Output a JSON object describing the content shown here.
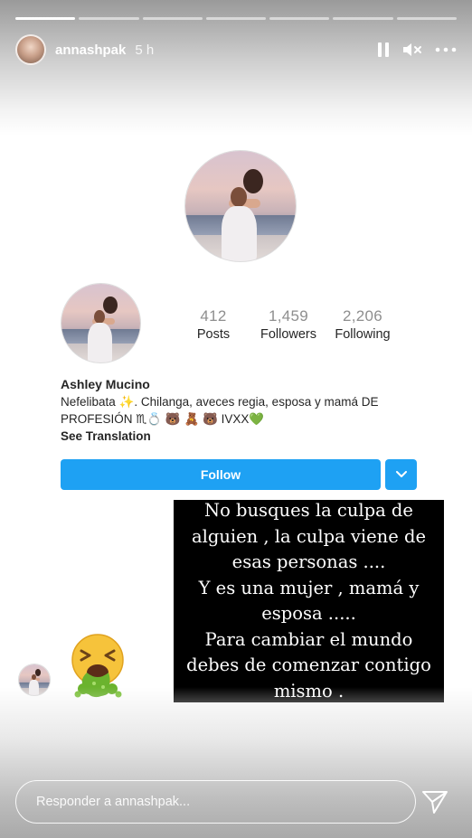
{
  "story": {
    "progress": [
      1,
      0,
      0,
      0,
      0,
      0,
      0
    ],
    "username": "annashpak",
    "time": "5 h",
    "icons": {
      "pause": "pause-icon",
      "mute": "volume-mute-icon",
      "more": "more-horizontal-icon",
      "send": "send-icon"
    }
  },
  "profile": {
    "stats": [
      {
        "value": "412",
        "label": "Posts"
      },
      {
        "value": "1,459",
        "label": "Followers"
      },
      {
        "value": "2,206",
        "label": "Following"
      }
    ],
    "name": "Ashley Mucino",
    "bio_line1": "Nefelibata ✨. Chilanga, aveces regia, esposa y mamá DE",
    "bio_line2": "PROFESIÓN ♏💍 🐻 🧸 🐻 IVXX💚",
    "see_translation": "See Translation",
    "follow_label": "Follow"
  },
  "quote": {
    "lines": [
      "No busques  la culpa de",
      "alguien , la culpa viene de",
      "esas personas ....",
      "Y es una mujer , mamá y",
      "esposa .....",
      "Para cambiar el mundo",
      "debes de comenzar  contigo",
      "mismo ."
    ]
  },
  "sticker": {
    "icon": "vomiting-face-emoji"
  },
  "reply": {
    "placeholder": "Responder a annashpak..."
  },
  "colors": {
    "follow_blue": "#1ea1f3",
    "quote_bg": "#000000"
  }
}
